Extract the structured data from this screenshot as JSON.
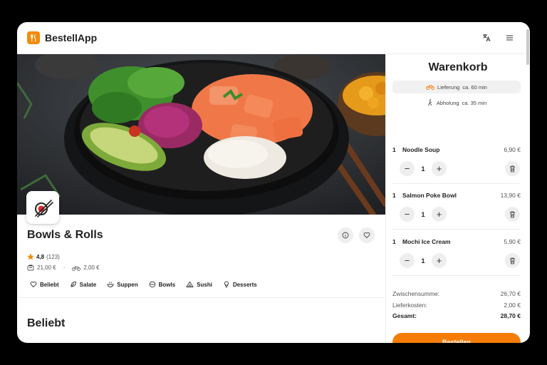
{
  "app": {
    "brand": "BestellApp"
  },
  "shop": {
    "name": "Bowls & Rolls",
    "rating": "4,8",
    "rating_count": "(123)",
    "min_order": "21,00 €",
    "delivery_fee": "2,00 €"
  },
  "categories": [
    {
      "label": "Beliebt",
      "icon": "heart-icon"
    },
    {
      "label": "Salate",
      "icon": "leaf-icon"
    },
    {
      "label": "Suppen",
      "icon": "soup-icon"
    },
    {
      "label": "Bowls",
      "icon": "bowl-icon"
    },
    {
      "label": "Sushi",
      "icon": "sushi-icon"
    },
    {
      "label": "Desserts",
      "icon": "icecream-icon"
    }
  ],
  "section": {
    "title": "Beliebt"
  },
  "cart": {
    "title": "Warenkorb",
    "delivery": {
      "label": "Lieferung",
      "time": "ca. 60 min"
    },
    "pickup": {
      "label": "Abholung",
      "time": "ca. 35 min"
    },
    "items": [
      {
        "qty": "1",
        "name": "Noodle Soup",
        "price": "6,90 €",
        "count": "1"
      },
      {
        "qty": "1",
        "name": "Salmon Poke Bowl",
        "price": "13,90 €",
        "count": "1"
      },
      {
        "qty": "1",
        "name": "Mochi Ice Cream",
        "price": "5,90 €",
        "count": "1"
      }
    ],
    "subtotal_label": "Zwischensumme:",
    "subtotal": "26,70 €",
    "delivery_label": "Lieferkosten:",
    "delivery_cost": "2,00 €",
    "total_label": "Gesamt:",
    "total": "28,70 €",
    "order_button": "Bestellen"
  },
  "colors": {
    "accent": "#f57d07"
  }
}
